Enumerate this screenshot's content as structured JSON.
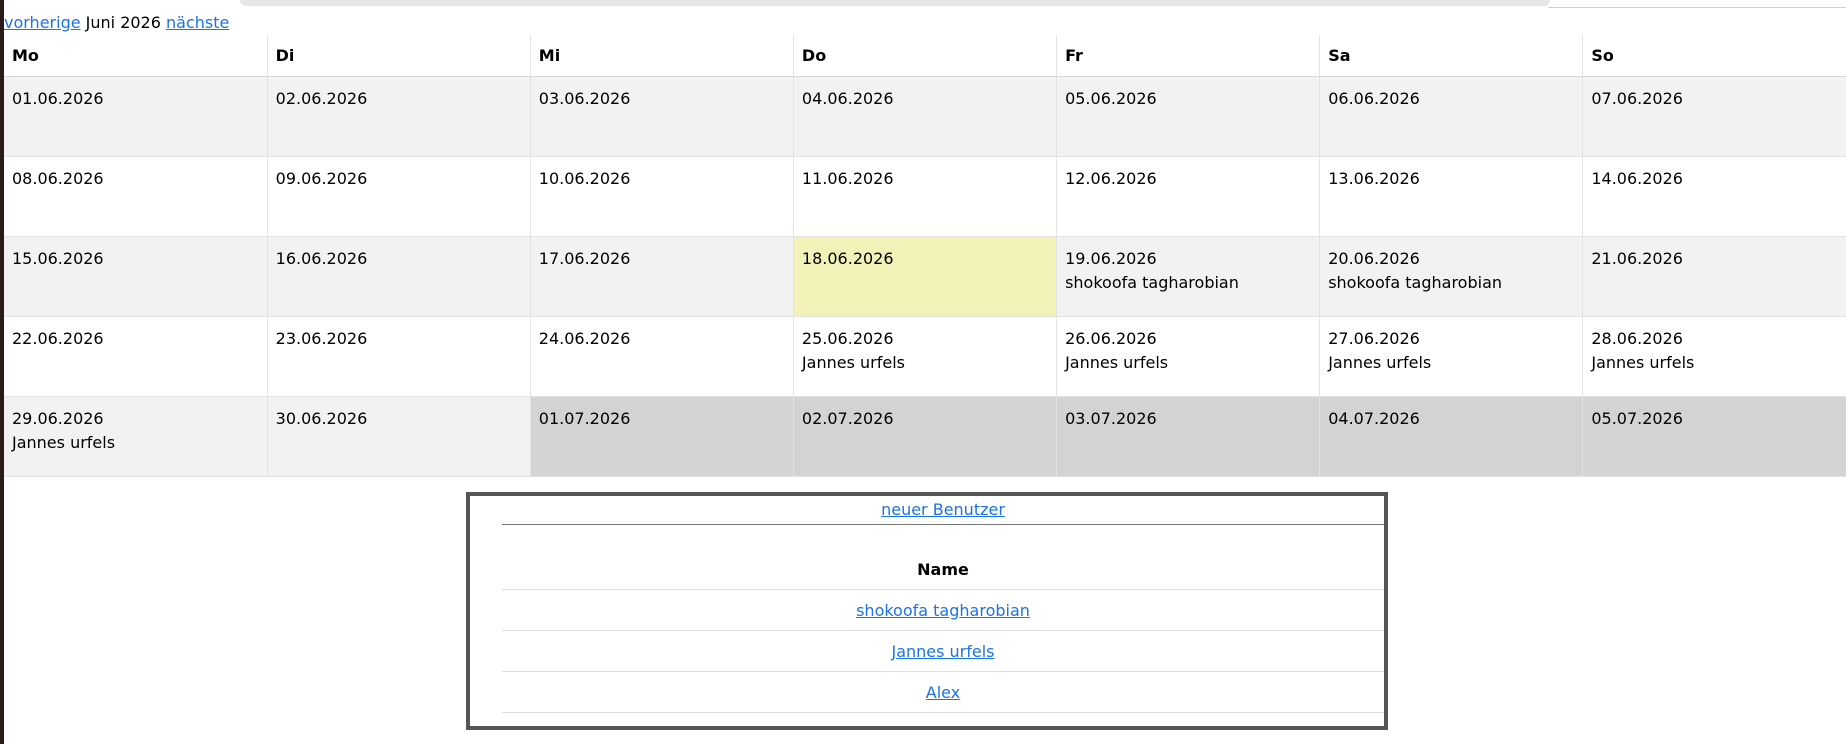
{
  "nav": {
    "prev": "vorherige",
    "month": "Juni 2026",
    "next": "nächste"
  },
  "calendar": {
    "days": [
      "Mo",
      "Di",
      "Mi",
      "Do",
      "Fr",
      "Sa",
      "So"
    ],
    "weeks": [
      [
        {
          "date": "01.06.2026",
          "name": ""
        },
        {
          "date": "02.06.2026",
          "name": ""
        },
        {
          "date": "03.06.2026",
          "name": ""
        },
        {
          "date": "04.06.2026",
          "name": ""
        },
        {
          "date": "05.06.2026",
          "name": ""
        },
        {
          "date": "06.06.2026",
          "name": ""
        },
        {
          "date": "07.06.2026",
          "name": ""
        }
      ],
      [
        {
          "date": "08.06.2026",
          "name": ""
        },
        {
          "date": "09.06.2026",
          "name": ""
        },
        {
          "date": "10.06.2026",
          "name": ""
        },
        {
          "date": "11.06.2026",
          "name": ""
        },
        {
          "date": "12.06.2026",
          "name": ""
        },
        {
          "date": "13.06.2026",
          "name": ""
        },
        {
          "date": "14.06.2026",
          "name": ""
        }
      ],
      [
        {
          "date": "15.06.2026",
          "name": ""
        },
        {
          "date": "16.06.2026",
          "name": ""
        },
        {
          "date": "17.06.2026",
          "name": ""
        },
        {
          "date": "18.06.2026",
          "name": ""
        },
        {
          "date": "19.06.2026",
          "name": "shokoofa tagharobian"
        },
        {
          "date": "20.06.2026",
          "name": "shokoofa tagharobian"
        },
        {
          "date": "21.06.2026",
          "name": ""
        }
      ],
      [
        {
          "date": "22.06.2026",
          "name": ""
        },
        {
          "date": "23.06.2026",
          "name": ""
        },
        {
          "date": "24.06.2026",
          "name": ""
        },
        {
          "date": "25.06.2026",
          "name": "Jannes urfels"
        },
        {
          "date": "26.06.2026",
          "name": "Jannes urfels"
        },
        {
          "date": "27.06.2026",
          "name": "Jannes urfels"
        },
        {
          "date": "28.06.2026",
          "name": "Jannes urfels"
        }
      ],
      [
        {
          "date": "29.06.2026",
          "name": "Jannes urfels"
        },
        {
          "date": "30.06.2026",
          "name": ""
        },
        {
          "date": "01.07.2026",
          "name": ""
        },
        {
          "date": "02.07.2026",
          "name": ""
        },
        {
          "date": "03.07.2026",
          "name": ""
        },
        {
          "date": "04.07.2026",
          "name": ""
        },
        {
          "date": "05.07.2026",
          "name": ""
        }
      ]
    ]
  },
  "users": {
    "new_user_label": "neuer Benutzer",
    "header": "Name",
    "list": [
      "shokoofa tagharobian",
      "Jannes urfels",
      "Alex"
    ]
  },
  "colors": {
    "link": "#1a73e8",
    "today": "#f2f2b8",
    "other_month": "#d3d3d3",
    "row_shade": "#f2f2f2",
    "box_border": "#555555"
  }
}
